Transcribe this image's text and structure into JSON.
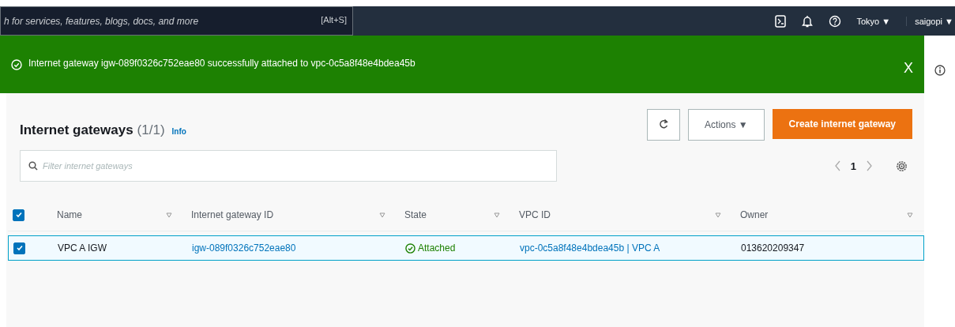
{
  "top_bar": {
    "search": {
      "placeholder": "h for services, features, blogs, docs, and more",
      "shortcut": "[Alt+S]"
    },
    "region": "Tokyo ▼",
    "user": "saigopi ▼"
  },
  "banner": {
    "message": "Internet gateway igw-089f0326c752eae80 successfully attached to vpc-0c5a8f48e4bdea45b",
    "close": "X"
  },
  "panel": {
    "title": "Internet gateways",
    "count": "(1/1)",
    "info": "Info",
    "actions": "Actions ▼",
    "create": "Create internet gateway",
    "filter": {
      "placeholder": "Filter internet gateways"
    },
    "page": "1"
  },
  "table": {
    "select_all": {
      "checked": true
    },
    "columns": [
      "Name",
      "Internet gateway ID",
      "State",
      "VPC ID",
      "Owner"
    ],
    "rows": [
      {
        "selected": true,
        "checked": true,
        "name": "VPC A IGW",
        "gateway_id": "igw-089f0326c752eae80",
        "state": "Attached",
        "vpc_id": "vpc-0c5a8f48e4bdea45b | VPC A",
        "owner": "013620209347"
      }
    ]
  }
}
